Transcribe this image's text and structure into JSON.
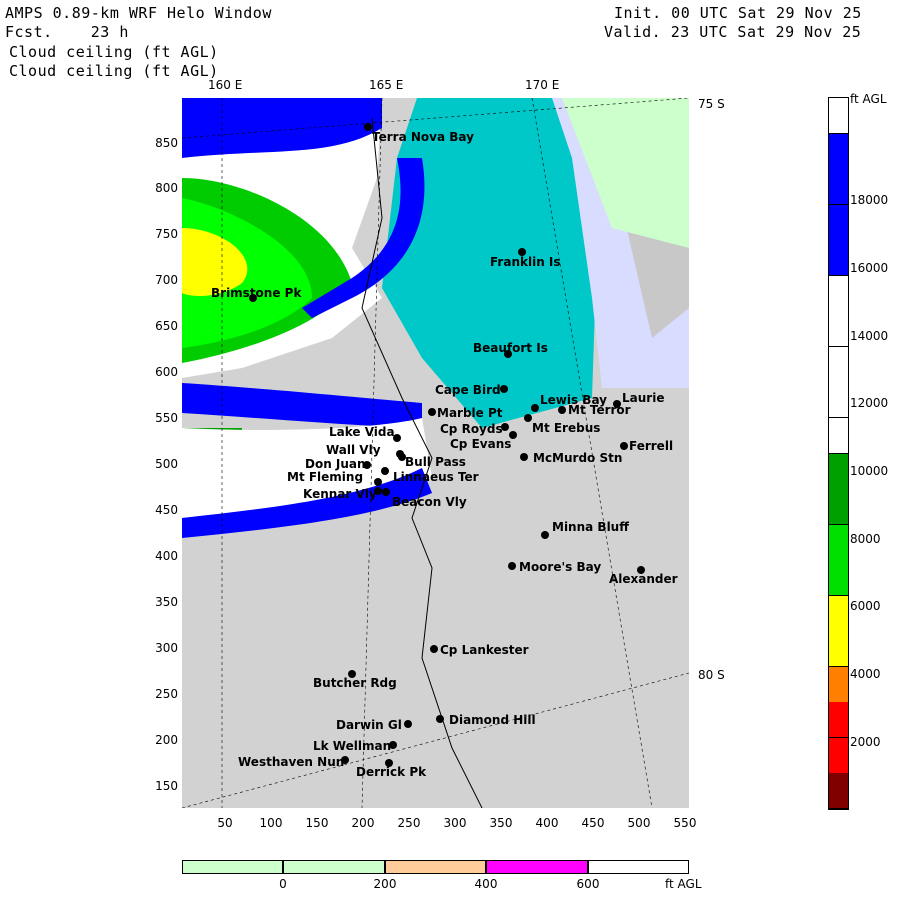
{
  "header": {
    "title_line": "AMPS 0.89-km WRF Helo Window",
    "fcst_line": "Fcst.    23 h",
    "field_line_1": "Cloud ceiling (ft AGL)",
    "field_line_2": "Cloud ceiling (ft AGL)",
    "init_line": "Init. 00 UTC Sat 29 Nov 25",
    "valid_line": "Valid. 23 UTC Sat 29 Nov 25"
  },
  "lon_labels": [
    "160 E",
    "165 E",
    "170 E"
  ],
  "lat_labels": [
    "75 S",
    "80 S"
  ],
  "y_ticks": [
    "850",
    "800",
    "750",
    "700",
    "650",
    "600",
    "550",
    "500",
    "450",
    "400",
    "350",
    "300",
    "250",
    "200",
    "150"
  ],
  "x_ticks": [
    "50",
    "100",
    "150",
    "200",
    "250",
    "300",
    "350",
    "400",
    "450",
    "500",
    "550"
  ],
  "places": [
    {
      "name": "Terra Nova Bay"
    },
    {
      "name": "Franklin Is"
    },
    {
      "name": "Brimstone Pk"
    },
    {
      "name": "Beaufort Is"
    },
    {
      "name": "Cape Bird"
    },
    {
      "name": "Lewis Bay"
    },
    {
      "name": "Laurie"
    },
    {
      "name": "Mt Terror"
    },
    {
      "name": "Marble Pt"
    },
    {
      "name": "Cp Royds"
    },
    {
      "name": "Mt Erebus"
    },
    {
      "name": "Lake Vida"
    },
    {
      "name": "Cp Evans"
    },
    {
      "name": "Ferrell"
    },
    {
      "name": "Wall Vly"
    },
    {
      "name": "Bull Pass"
    },
    {
      "name": "Don Juan"
    },
    {
      "name": "McMurdo Stn"
    },
    {
      "name": "Mt Fleming"
    },
    {
      "name": "Linnaeus Ter"
    },
    {
      "name": "Kennar Vly"
    },
    {
      "name": "Beacon Vly"
    },
    {
      "name": "Minna Bluff"
    },
    {
      "name": "Moore's Bay"
    },
    {
      "name": "Alexander"
    },
    {
      "name": "Cp Lankester"
    },
    {
      "name": "Butcher Rdg"
    },
    {
      "name": "Darwin Gl"
    },
    {
      "name": "Diamond Hill"
    },
    {
      "name": "Lk Wellman"
    },
    {
      "name": "Westhaven Nun"
    },
    {
      "name": "Derrick Pk"
    }
  ],
  "ceiling_colorbar": {
    "unit": "ft AGL",
    "labels": [
      "18000",
      "16000",
      "14000",
      "12000",
      "10000",
      "8000",
      "6000",
      "4000",
      "2000"
    ],
    "colors": [
      "#ffffff",
      "#0000ff",
      "#0000ff",
      "#0000ff",
      "#0000ff",
      "#ffffff",
      "#ffffff",
      "#ffffff",
      "#ffffff",
      "#ffffff",
      "#00a000",
      "#00a000",
      "#00e000",
      "#00e000",
      "#ffff00",
      "#ffff00",
      "#ff8000",
      "#ff0000",
      "#ff0000",
      "#800000"
    ]
  },
  "terrain_colorbar": {
    "unit": "ft AGL",
    "labels": [
      "0",
      "200",
      "400",
      "600"
    ],
    "colors": [
      "#ccffcc",
      "#ccffcc",
      "#ffcc99",
      "#ff00ff",
      "#ffffff"
    ]
  },
  "colors": {
    "sea_ice": "#00c8c8",
    "cloud_blue": "#0000ff",
    "land_gray": "#d2d2d2",
    "light_green": "#ccffcc"
  }
}
